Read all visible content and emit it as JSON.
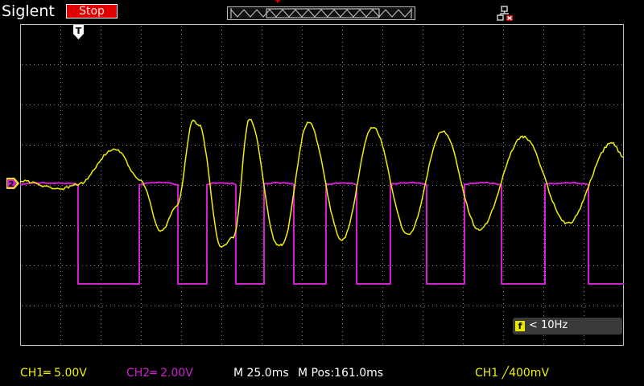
{
  "header": {
    "brand": "Siglent",
    "run_state": "Stop"
  },
  "status": {
    "ch1": "CH1═ 5.00V",
    "ch2": "CH2═ 2.00V",
    "timebase": "M 25.0ms",
    "mpos": "M Pos:161.0ms",
    "trigger": "CH1 ╱400mV"
  },
  "frequency": {
    "icon_label": "f",
    "text": "< 10Hz"
  },
  "markers": {
    "trigger_label": "T",
    "channel_label": "2"
  },
  "icons": [
    "network-status-icon",
    "trigger-position-icon",
    "memory-depth-icon"
  ],
  "colors": {
    "ch1": "#f0f000",
    "ch2": "#d020d0",
    "run_state_bg": "#e00000",
    "grid": "#8a8a8a"
  },
  "chart_data": {
    "type": "line",
    "title": "",
    "xlabel": "",
    "ylabel": "",
    "grid": true,
    "divisions": {
      "x": 15,
      "y": 8
    },
    "series": [
      {
        "name": "CH1",
        "color": "#f0f000"
      },
      {
        "name": "CH2",
        "color": "#d020d0"
      }
    ]
  }
}
